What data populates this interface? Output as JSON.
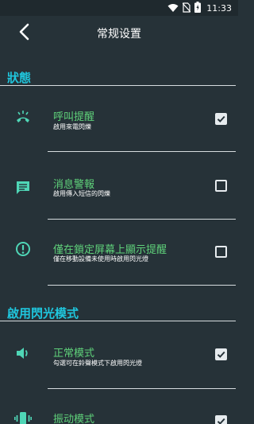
{
  "status_bar": {
    "time": "11:33",
    "icons": [
      "wifi-icon",
      "no-sim-icon",
      "battery-icon"
    ]
  },
  "header": {
    "title": "常规设置",
    "back_icon": "back-chevron-icon"
  },
  "sections": [
    {
      "title": "狀態",
      "items": [
        {
          "icon": "incoming-call-icon",
          "title": "呼叫提醒",
          "subtitle": "啟用來電閃爍",
          "checked": true
        },
        {
          "icon": "message-icon",
          "title": "消息警報",
          "subtitle": "啟用傳入短信的閃爍",
          "checked": false
        },
        {
          "icon": "alert-circle-icon",
          "title": "僅在鎖定屏幕上顯示提醒",
          "subtitle": "僅在移動設備未使用時啟用閃光燈",
          "checked": false
        }
      ]
    },
    {
      "title": "啟用閃光模式",
      "items": [
        {
          "icon": "volume-icon",
          "title": "正常模式",
          "subtitle": "勾選可在鈴聲模式下啟用閃光燈",
          "checked": true
        },
        {
          "icon": "vibrate-icon",
          "title": "振动模式",
          "subtitle": "",
          "checked": true
        }
      ]
    }
  ],
  "colors": {
    "background": "#263238",
    "accent_header": "#1fc6dd",
    "item_title": "#5fd17a",
    "icon_teal": "#4fd6b6"
  }
}
